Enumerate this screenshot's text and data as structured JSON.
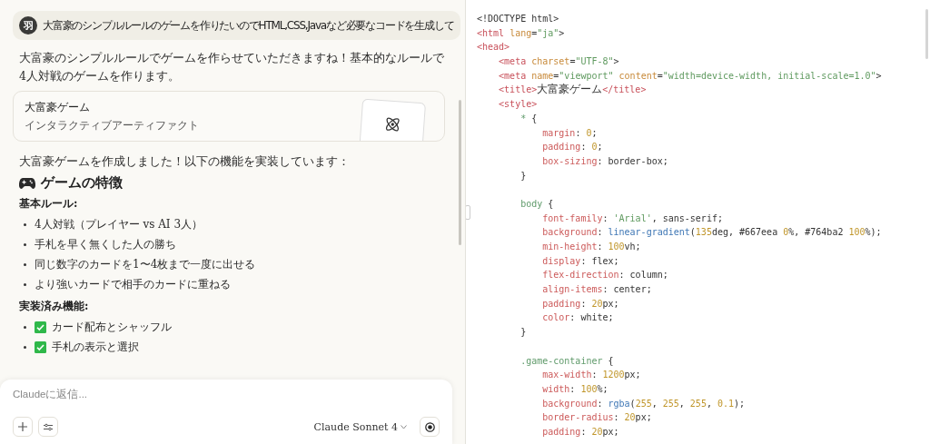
{
  "chat": {
    "user_message": {
      "avatar": "羽",
      "text": "大富豪のシンプルルールのゲームを作りたいのでHTML,CSS,Javaなど必要なコードを生成して"
    },
    "intro": "大富豪のシンプルルールでゲームを作らせていただきますね！基本的なルールで4人対戦のゲームを作ります。",
    "artifact": {
      "title": "大富豪ゲーム",
      "subtitle": "インタラクティブアーティファクト"
    },
    "summary": "大富豪ゲームを作成しました！以下の機能を実装しています：",
    "heading": "ゲームの特徴",
    "sections": [
      {
        "title": "基本ルール:",
        "items": [
          {
            "text": "4人対戦（プレイヤー vs AI 3人）",
            "done": false
          },
          {
            "text": "手札を早く無くした人の勝ち",
            "done": false
          },
          {
            "text": "同じ数字のカードを1〜4枚まで一度に出せる",
            "done": false
          },
          {
            "text": "より強いカードで相手のカードに重ねる",
            "done": false
          }
        ]
      },
      {
        "title": "実装済み機能:",
        "items": [
          {
            "text": "カード配布とシャッフル",
            "done": true
          },
          {
            "text": "手札の表示と選択",
            "done": true
          }
        ]
      }
    ]
  },
  "composer": {
    "placeholder": "Claudeに返信...",
    "model": "Claude Sonnet 4"
  },
  "code": [
    {
      "kind": "code",
      "tokens": [
        {
          "kind": "plain",
          "text": "<!DOCTYPE html>"
        }
      ]
    },
    {
      "kind": "code",
      "tokens": [
        {
          "kind": "tag",
          "text": "<html "
        },
        {
          "kind": "attr",
          "text": "lang"
        },
        {
          "kind": "plain",
          "text": "="
        },
        {
          "kind": "string",
          "text": "\"ja\""
        },
        {
          "kind": "plain",
          "text": ">"
        }
      ]
    },
    {
      "kind": "code",
      "tokens": [
        {
          "kind": "tag",
          "text": "<head>"
        }
      ]
    },
    {
      "kind": "code",
      "tokens": [
        {
          "kind": "tag",
          "text": "    <meta "
        },
        {
          "kind": "attr",
          "text": "charset"
        },
        {
          "kind": "plain",
          "text": "="
        },
        {
          "kind": "string",
          "text": "\"UTF-8\""
        },
        {
          "kind": "plain",
          "text": ">"
        }
      ]
    },
    {
      "kind": "code",
      "tokens": [
        {
          "kind": "tag",
          "text": "    <meta "
        },
        {
          "kind": "attr",
          "text": "name"
        },
        {
          "kind": "plain",
          "text": "="
        },
        {
          "kind": "string",
          "text": "\"viewport\" "
        },
        {
          "kind": "attr",
          "text": "content"
        },
        {
          "kind": "plain",
          "text": "="
        },
        {
          "kind": "string",
          "text": "\"width=device-width, initial-scale=1.0\""
        },
        {
          "kind": "plain",
          "text": ">"
        }
      ]
    },
    {
      "kind": "code",
      "tokens": [
        {
          "kind": "tag",
          "text": "    <title>"
        },
        {
          "kind": "plain",
          "text": "大富豪ゲーム"
        },
        {
          "kind": "tag",
          "text": "</title>"
        }
      ]
    },
    {
      "kind": "code",
      "tokens": [
        {
          "kind": "tag",
          "text": "    <style>"
        }
      ]
    },
    {
      "kind": "code",
      "tokens": [
        {
          "kind": "selector",
          "text": "        * "
        },
        {
          "kind": "plain",
          "text": "{"
        }
      ]
    },
    {
      "kind": "code",
      "tokens": [
        {
          "kind": "prop",
          "text": "            margin"
        },
        {
          "kind": "plain",
          "text": ": "
        },
        {
          "kind": "number",
          "text": "0"
        },
        {
          "kind": "plain",
          "text": ";"
        }
      ]
    },
    {
      "kind": "code",
      "tokens": [
        {
          "kind": "prop",
          "text": "            padding"
        },
        {
          "kind": "plain",
          "text": ": "
        },
        {
          "kind": "number",
          "text": "0"
        },
        {
          "kind": "plain",
          "text": ";"
        }
      ]
    },
    {
      "kind": "code",
      "tokens": [
        {
          "kind": "prop",
          "text": "            box-sizing"
        },
        {
          "kind": "plain",
          "text": ": border-box;"
        }
      ]
    },
    {
      "kind": "code",
      "tokens": [
        {
          "kind": "plain",
          "text": "        }"
        }
      ]
    },
    {
      "kind": "blank"
    },
    {
      "kind": "code",
      "tokens": [
        {
          "kind": "selector",
          "text": "        body "
        },
        {
          "kind": "plain",
          "text": "{"
        }
      ]
    },
    {
      "kind": "code",
      "tokens": [
        {
          "kind": "prop",
          "text": "            font-family"
        },
        {
          "kind": "plain",
          "text": ": "
        },
        {
          "kind": "string",
          "text": "'Arial'"
        },
        {
          "kind": "plain",
          "text": ", sans-serif;"
        }
      ]
    },
    {
      "kind": "code",
      "tokens": [
        {
          "kind": "prop",
          "text": "            background"
        },
        {
          "kind": "plain",
          "text": ": "
        },
        {
          "kind": "func",
          "text": "linear-gradient"
        },
        {
          "kind": "plain",
          "text": "("
        },
        {
          "kind": "number",
          "text": "135"
        },
        {
          "kind": "plain",
          "text": "deg, #667eea "
        },
        {
          "kind": "number",
          "text": "0"
        },
        {
          "kind": "plain",
          "text": "%, #764ba2 "
        },
        {
          "kind": "number",
          "text": "100"
        },
        {
          "kind": "plain",
          "text": "%);"
        }
      ]
    },
    {
      "kind": "code",
      "tokens": [
        {
          "kind": "prop",
          "text": "            min-height"
        },
        {
          "kind": "plain",
          "text": ": "
        },
        {
          "kind": "number",
          "text": "100"
        },
        {
          "kind": "plain",
          "text": "vh;"
        }
      ]
    },
    {
      "kind": "code",
      "tokens": [
        {
          "kind": "prop",
          "text": "            display"
        },
        {
          "kind": "plain",
          "text": ": flex;"
        }
      ]
    },
    {
      "kind": "code",
      "tokens": [
        {
          "kind": "prop",
          "text": "            flex-direction"
        },
        {
          "kind": "plain",
          "text": ": column;"
        }
      ]
    },
    {
      "kind": "code",
      "tokens": [
        {
          "kind": "prop",
          "text": "            align-items"
        },
        {
          "kind": "plain",
          "text": ": center;"
        }
      ]
    },
    {
      "kind": "code",
      "tokens": [
        {
          "kind": "prop",
          "text": "            padding"
        },
        {
          "kind": "plain",
          "text": ": "
        },
        {
          "kind": "number",
          "text": "20"
        },
        {
          "kind": "plain",
          "text": "px;"
        }
      ]
    },
    {
      "kind": "code",
      "tokens": [
        {
          "kind": "prop",
          "text": "            color"
        },
        {
          "kind": "plain",
          "text": ": white;"
        }
      ]
    },
    {
      "kind": "code",
      "tokens": [
        {
          "kind": "plain",
          "text": "        }"
        }
      ]
    },
    {
      "kind": "blank"
    },
    {
      "kind": "code",
      "tokens": [
        {
          "kind": "selector",
          "text": "        .game-container "
        },
        {
          "kind": "plain",
          "text": "{"
        }
      ]
    },
    {
      "kind": "code",
      "tokens": [
        {
          "kind": "prop",
          "text": "            max-width"
        },
        {
          "kind": "plain",
          "text": ": "
        },
        {
          "kind": "number",
          "text": "1200"
        },
        {
          "kind": "plain",
          "text": "px;"
        }
      ]
    },
    {
      "kind": "code",
      "tokens": [
        {
          "kind": "prop",
          "text": "            width"
        },
        {
          "kind": "plain",
          "text": ": "
        },
        {
          "kind": "number",
          "text": "100"
        },
        {
          "kind": "plain",
          "text": "%;"
        }
      ]
    },
    {
      "kind": "code",
      "tokens": [
        {
          "kind": "prop",
          "text": "            background"
        },
        {
          "kind": "plain",
          "text": ": "
        },
        {
          "kind": "func",
          "text": "rgba"
        },
        {
          "kind": "plain",
          "text": "("
        },
        {
          "kind": "number",
          "text": "255"
        },
        {
          "kind": "plain",
          "text": ", "
        },
        {
          "kind": "number",
          "text": "255"
        },
        {
          "kind": "plain",
          "text": ", "
        },
        {
          "kind": "number",
          "text": "255"
        },
        {
          "kind": "plain",
          "text": ", "
        },
        {
          "kind": "number",
          "text": "0.1"
        },
        {
          "kind": "plain",
          "text": ");"
        }
      ]
    },
    {
      "kind": "code",
      "tokens": [
        {
          "kind": "prop",
          "text": "            border-radius"
        },
        {
          "kind": "plain",
          "text": ": "
        },
        {
          "kind": "number",
          "text": "20"
        },
        {
          "kind": "plain",
          "text": "px;"
        }
      ]
    },
    {
      "kind": "code",
      "tokens": [
        {
          "kind": "prop",
          "text": "            padding"
        },
        {
          "kind": "plain",
          "text": ": "
        },
        {
          "kind": "number",
          "text": "20"
        },
        {
          "kind": "plain",
          "text": "px;"
        }
      ]
    }
  ]
}
